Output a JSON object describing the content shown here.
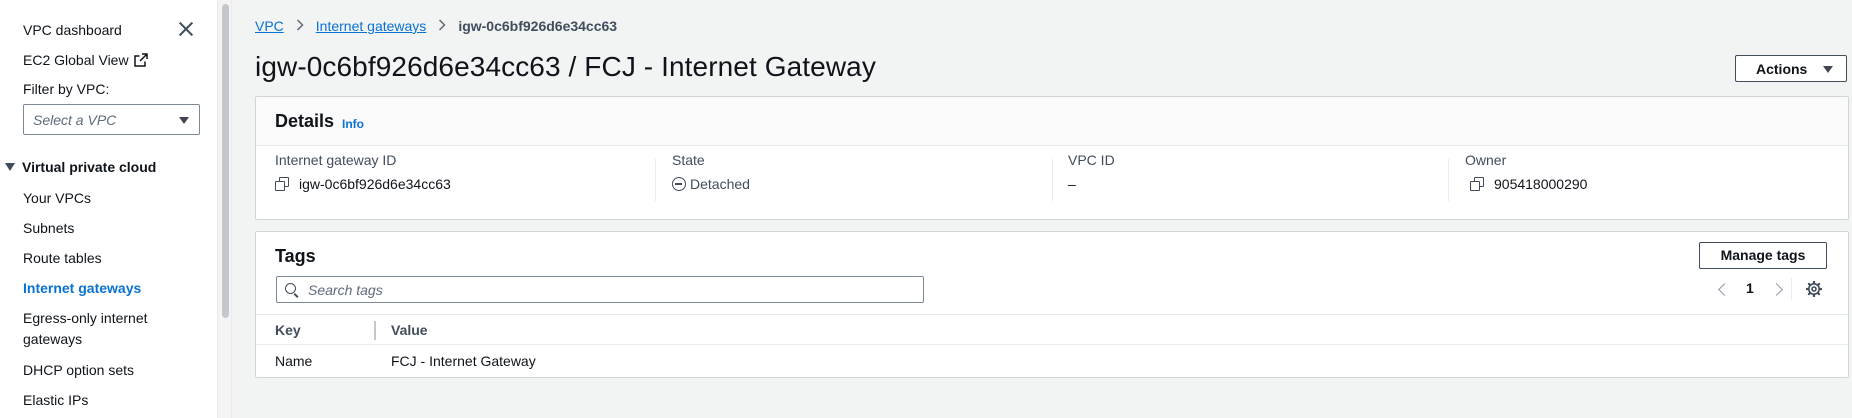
{
  "sidebar": {
    "title": "VPC dashboard",
    "ec2_link": "EC2 Global View",
    "filter_label": "Filter by VPC:",
    "filter_placeholder": "Select a VPC",
    "section_title": "Virtual private cloud",
    "items": [
      {
        "label": "Your VPCs"
      },
      {
        "label": "Subnets"
      },
      {
        "label": "Route tables"
      },
      {
        "label": "Internet gateways",
        "active": true
      },
      {
        "label": "Egress-only internet gateways"
      },
      {
        "label": "DHCP option sets"
      },
      {
        "label": "Elastic IPs"
      }
    ]
  },
  "breadcrumb": {
    "items": [
      "VPC",
      "Internet gateways"
    ],
    "current": "igw-0c6bf926d6e34cc63"
  },
  "page": {
    "title": "igw-0c6bf926d6e34cc63 / FCJ - Internet Gateway",
    "actions_label": "Actions"
  },
  "details": {
    "title": "Details",
    "info": "Info",
    "fields": [
      {
        "label": "Internet gateway ID",
        "value": "igw-0c6bf926d6e34cc63"
      },
      {
        "label": "State",
        "value": "Detached"
      },
      {
        "label": "VPC ID",
        "value": "–"
      },
      {
        "label": "Owner",
        "value": "905418000290"
      }
    ]
  },
  "tags": {
    "title": "Tags",
    "manage_label": "Manage tags",
    "search_placeholder": "Search tags",
    "page_number": "1",
    "columns": [
      "Key",
      "Value"
    ],
    "rows": [
      {
        "key": "Name",
        "value": "FCJ - Internet Gateway"
      }
    ]
  },
  "colors": {
    "accent": "#0972d3",
    "text": "#0f141a",
    "muted": "#414d5c",
    "background": "#f2f3f3"
  }
}
